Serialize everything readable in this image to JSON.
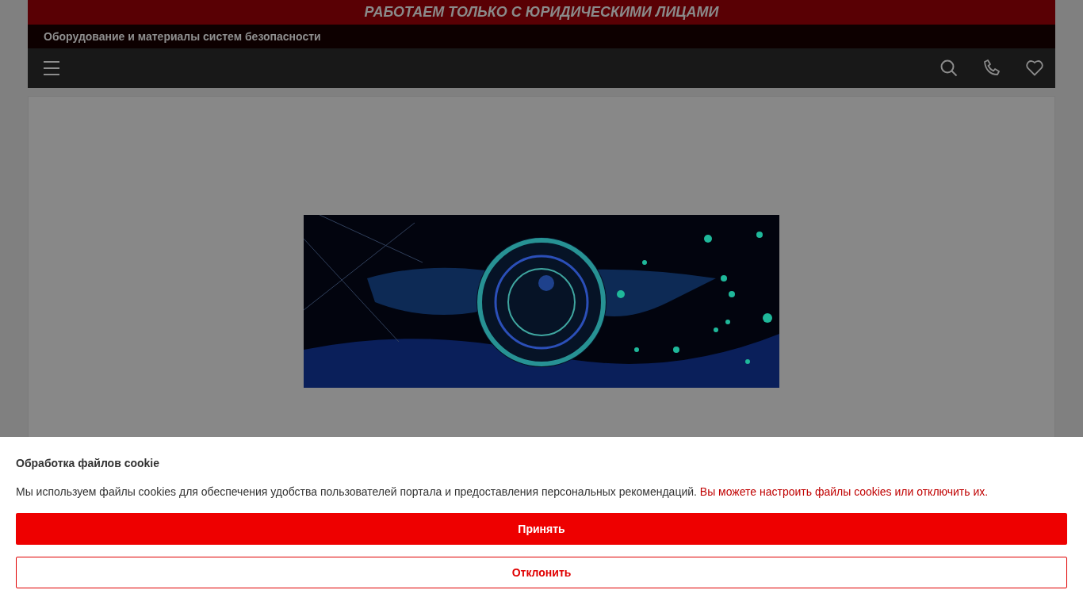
{
  "top_banner": {
    "text": "РАБОТАЕМ ТОЛЬКО С ЮРИДИЧЕСКИМИ ЛИЦАМИ"
  },
  "subtitle": "Оборудование и материалы систем безопасности",
  "toolbar": {
    "icons": [
      {
        "kind": "search"
      },
      {
        "kind": "phone"
      },
      {
        "kind": "heart"
      }
    ]
  },
  "cookie_dialog": {
    "title": "Обработка файлов cookie",
    "text": "Мы используем файлы cookies для обеспечения удобства пользователей портала и предоставления персональных рекомендаций.",
    "link": "Вы можете настроить файлы cookies или отключить их.",
    "buttons": [
      {
        "label": "Принять",
        "kind": "primary"
      },
      {
        "label": "Отклонить",
        "kind": "outline"
      }
    ]
  }
}
